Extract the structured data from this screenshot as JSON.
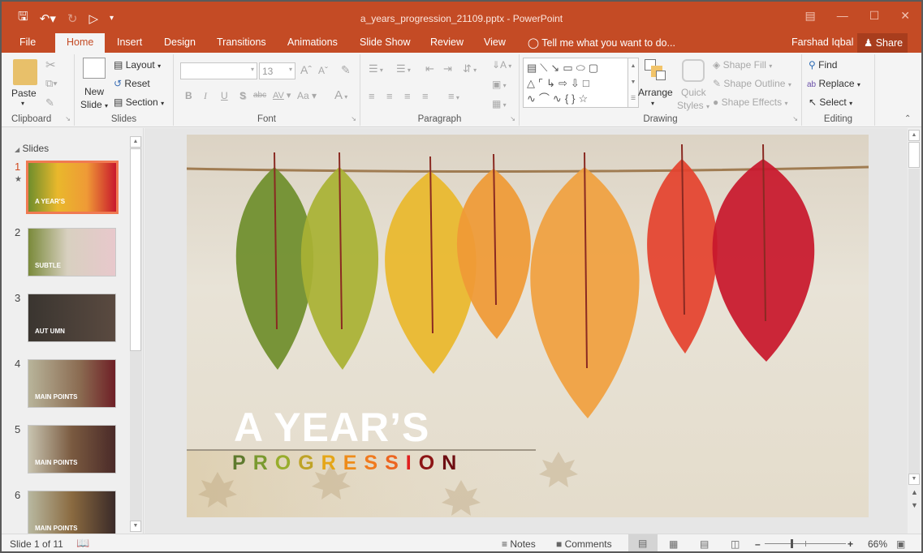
{
  "window": {
    "title": "a_years_progression_21109.pptx - PowerPoint",
    "accent": "#c44b25"
  },
  "qat": {
    "save_icon": "save-icon",
    "undo_icon": "undo-icon",
    "redo_icon": "redo-icon",
    "present_icon": "present-from-start-icon",
    "customize_icon": "customize-qat-icon"
  },
  "tabs": [
    {
      "label": "File"
    },
    {
      "label": "Home"
    },
    {
      "label": "Insert"
    },
    {
      "label": "Design"
    },
    {
      "label": "Transitions"
    },
    {
      "label": "Animations"
    },
    {
      "label": "Slide Show"
    },
    {
      "label": "Review"
    },
    {
      "label": "View"
    }
  ],
  "tell_me": "Tell me what you want to do...",
  "user": "Farshad Iqbal",
  "share": "Share",
  "ribbon": {
    "clipboard": {
      "label": "Clipboard",
      "paste": "Paste"
    },
    "slides": {
      "label": "Slides",
      "new_slide_1": "New",
      "new_slide_2": "Slide",
      "layout": "Layout",
      "reset": "Reset",
      "section": "Section"
    },
    "font": {
      "label": "Font",
      "font_name": "",
      "font_size": "13",
      "bold": "B",
      "italic": "I",
      "underline": "U",
      "shadow": "S",
      "strike": "abc",
      "spacing": "AV",
      "case": "Aa",
      "color": "A"
    },
    "paragraph": {
      "label": "Paragraph"
    },
    "drawing": {
      "label": "Drawing",
      "arrange": "Arrange",
      "quick_styles_1": "Quick",
      "quick_styles_2": "Styles",
      "shape_fill": "Shape Fill",
      "shape_outline": "Shape Outline",
      "shape_effects": "Shape Effects"
    },
    "editing": {
      "label": "Editing",
      "find": "Find",
      "replace": "Replace",
      "select": "Select"
    }
  },
  "slides_panel": {
    "heading": "Slides",
    "thumbnails": [
      {
        "num": "1",
        "selected": true,
        "caption": "A YEAR'S"
      },
      {
        "num": "2",
        "selected": false,
        "caption": "SUBTLE"
      },
      {
        "num": "3",
        "selected": false,
        "caption": "AUT UMN"
      },
      {
        "num": "4",
        "selected": false,
        "caption": "MAIN POINTS"
      },
      {
        "num": "5",
        "selected": false,
        "caption": "MAIN POINTS"
      },
      {
        "num": "6",
        "selected": false,
        "caption": "MAIN POINTS"
      }
    ]
  },
  "slide": {
    "title": "A YEAR’S",
    "subtitle_letters": [
      {
        "ch": "P",
        "color": "#5e7a2e"
      },
      {
        "ch": "R",
        "color": "#7a9a30"
      },
      {
        "ch": "O",
        "color": "#98ad2c"
      },
      {
        "ch": "G",
        "color": "#bfa326"
      },
      {
        "ch": "R",
        "color": "#e5a617"
      },
      {
        "ch": "E",
        "color": "#ee8c1a"
      },
      {
        "ch": "S",
        "color": "#f07a1e"
      },
      {
        "ch": "S",
        "color": "#ec6520"
      },
      {
        "ch": "I",
        "color": "#e02020"
      },
      {
        "ch": "O",
        "color": "#8c1515"
      },
      {
        "ch": "N",
        "color": "#6e0d12"
      }
    ],
    "leaves": [
      "#6f8e2c",
      "#a9b234",
      "#e9b82c",
      "#ef9a36",
      "#f0a040",
      "#e4432e",
      "#c8182c"
    ]
  },
  "status": {
    "slide_of": "Slide 1 of 11",
    "notes": "Notes",
    "comments": "Comments",
    "zoom": "66%",
    "zoom_fraction": 0.66
  }
}
